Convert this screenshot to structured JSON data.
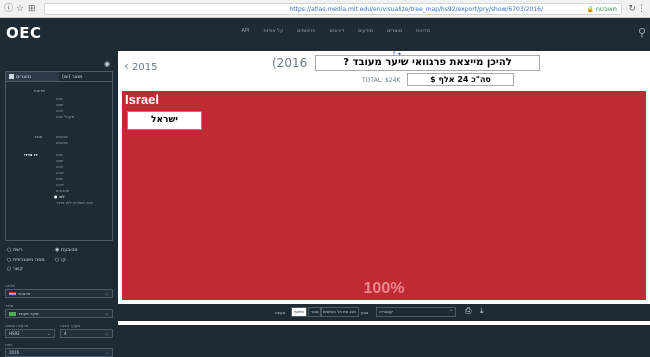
{
  "browser": {
    "url": "https://atlas.media.mit.edu/en/visualize/tree_map/hs92/export/pry/show/6703/2016/",
    "secure_label": "מאובטח"
  },
  "header": {
    "logo": "OEC",
    "nav": [
      "API",
      "על אודות",
      "פרסומים",
      "דירוגים",
      "מודעים",
      "מוצרים",
      "מדינות"
    ]
  },
  "sidebar": {
    "tabs": [
      "מוצרים",
      "מוצר (ים)"
    ],
    "category_rows": [
      {
        "label": "מדינות",
        "items": [
          "יבוא",
          "יצוא",
          "יבוא",
          "מקבל יבוא"
        ]
      },
      {
        "label": "מוצר",
        "items": [
          "יבואנים",
          "יצואנים"
        ]
      },
      {
        "label": "דו צדדי",
        "items": [
          "יבוא",
          "יצוא",
          "יבוא",
          "ייבוא",
          "יצוא",
          "ייבוא",
          "מיובאים"
        ]
      }
    ],
    "selected_row": "● לאי",
    "extra_row": "יבוא מוצרים לאו מוצר",
    "radios": [
      {
        "label": "מכובעת",
        "on": true
      },
      {
        "label": "רשת",
        "on": false
      },
      {
        "label": "קו",
        "on": false
      },
      {
        "label": "מפה גיאוגרפית",
        "on": false
      },
      {
        "label": "קשר",
        "on": false
      }
    ],
    "country_label": "מדינה",
    "country_value": "פרגוואי",
    "product_label": "מוצר",
    "product_value": "שיער מעובד",
    "source_label": "ארגום המסווג",
    "source_value": "HS92",
    "depth_label": "מערך הצגה",
    "depth_value": "4",
    "year_label": "שנה",
    "year_value": "2016"
  },
  "main": {
    "social": "f  ✦",
    "prev_year": "2015",
    "year_title": "(2016",
    "hebrew_question": "להיכן מייצאת פרגוואי שיער מעובד ?",
    "total": "TOTAL: $24K",
    "hebrew_total": "סה\"כ 24 אלף $"
  },
  "chart_data": {
    "type": "treemap",
    "title": "",
    "cells": [
      {
        "label": "Israel",
        "share_label": "100%",
        "value": 100,
        "color": "#c02a32"
      }
    ],
    "overlay_label": "ישראל"
  },
  "controls": {
    "labels": [
      "טעינה",
      "שיתוף",
      "סגור"
    ],
    "view_label": "הצג את כל הנתונים",
    "scale_label": "צבע",
    "scale_value": "קטגוריה"
  },
  "colors": {
    "nav_bg": "#1e2a34",
    "treemap_cell": "#c02a32",
    "link": "#3a70c0"
  }
}
